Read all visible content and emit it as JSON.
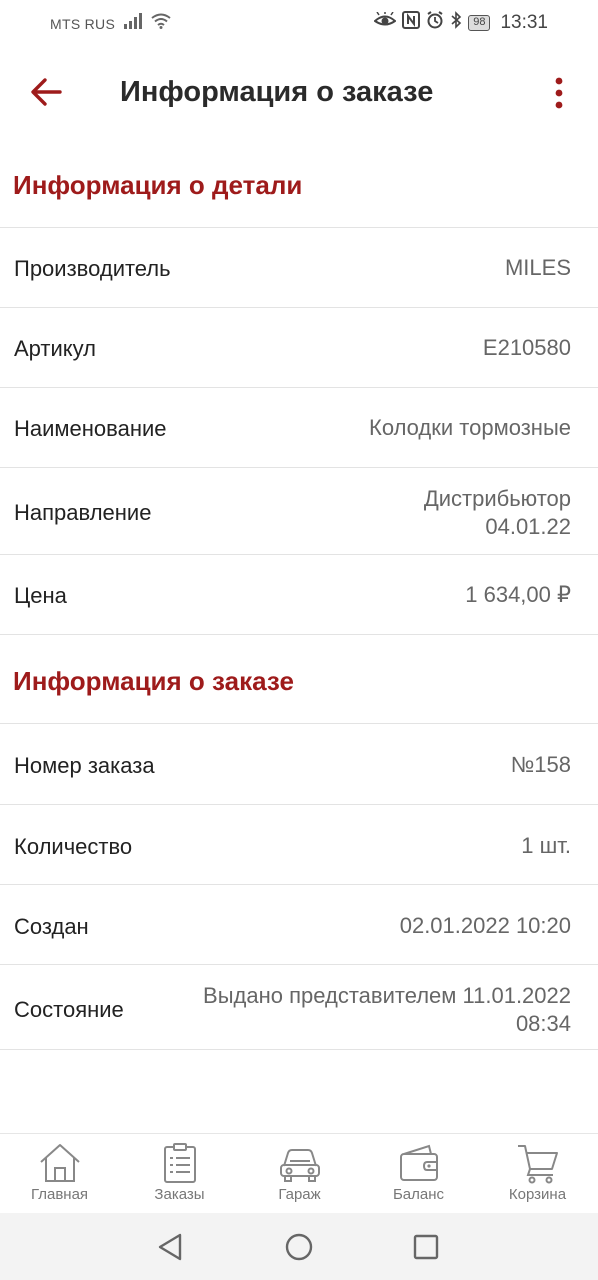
{
  "status_bar": {
    "carrier": "MTS RUS",
    "battery": "98",
    "time": "13:31"
  },
  "app_bar": {
    "title": "Информация о заказе",
    "back_icon": "arrow-left-icon",
    "menu_icon": "more-vert-icon"
  },
  "part_info": {
    "title": "Информация о детали",
    "rows": [
      {
        "label": "Производитель",
        "value": "MILES"
      },
      {
        "label": "Артикул",
        "value": "E210580"
      },
      {
        "label": "Наименование",
        "value": "Колодки тормозные"
      },
      {
        "label": "Направление",
        "value": "Дистрибьютор",
        "value2": "04.01.22"
      },
      {
        "label": "Цена",
        "value": "1 634,00 ₽"
      }
    ]
  },
  "order_info": {
    "title": "Информация о заказе",
    "rows": [
      {
        "label": "Номер заказа",
        "value": "№158"
      },
      {
        "label": "Количество",
        "value": "1 шт."
      },
      {
        "label": "Создан",
        "value": "02.01.2022 10:20"
      },
      {
        "label": "Состояние",
        "value": "Выдано представителем 11.01.2022",
        "value2": "08:34"
      }
    ]
  },
  "bottom_nav": {
    "items": [
      {
        "label": "Главная",
        "icon": "home-icon"
      },
      {
        "label": "Заказы",
        "icon": "orders-clipboard-icon"
      },
      {
        "label": "Гараж",
        "icon": "car-icon"
      },
      {
        "label": "Баланс",
        "icon": "wallet-icon"
      },
      {
        "label": "Корзина",
        "icon": "cart-icon"
      }
    ]
  },
  "colors": {
    "accent": "#9e1b1b",
    "text": "#222222",
    "value_text": "#666666",
    "divider": "#e3e3e3"
  }
}
